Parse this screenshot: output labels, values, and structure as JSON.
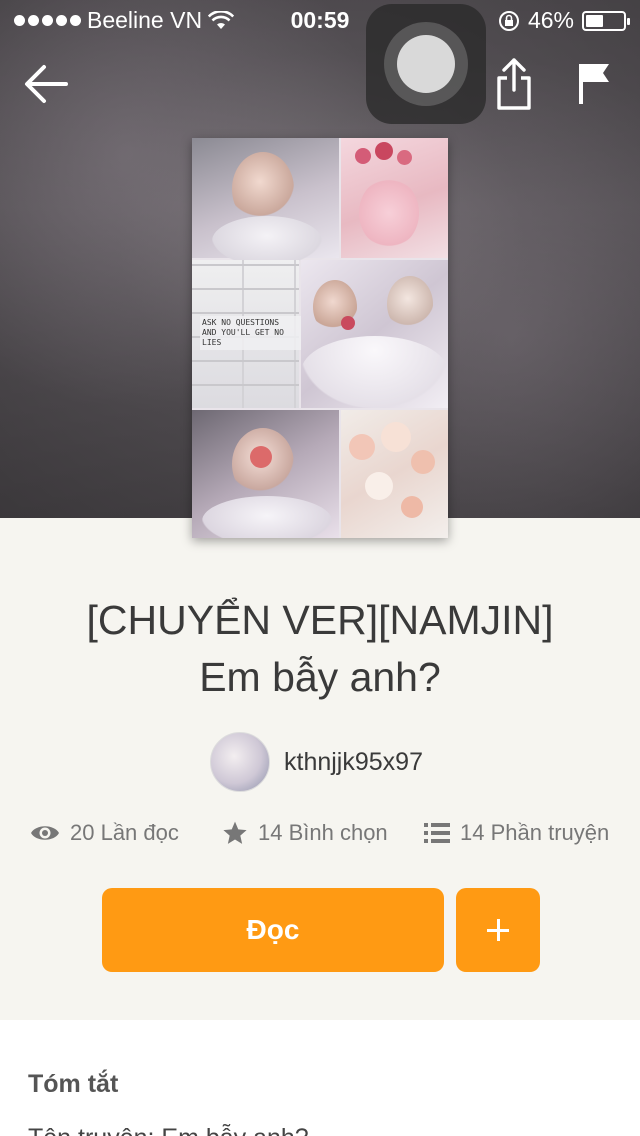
{
  "status_bar": {
    "carrier": "Beeline VN",
    "time": "00:59",
    "battery_percent_text": "46%",
    "battery_level": 0.46
  },
  "story": {
    "title_line1": "[CHUYỂN VER][NAMJIN]",
    "title_line2": "Em bẫy anh?",
    "author": "kthnjjk95x97",
    "cover_text_line1": "ASK NO QUESTIONS",
    "cover_text_line2": "AND YOU'LL GET NO LIES"
  },
  "stats": {
    "reads": "20 Lần đọc",
    "votes": "14 Bình chọn",
    "parts": "14 Phần truyện"
  },
  "actions": {
    "read_label": "Đọc"
  },
  "summary": {
    "heading": "Tóm tắt",
    "first_line": "Tên truyện: Em bẫy anh?"
  },
  "icons": [
    "back-arrow-icon",
    "share-icon",
    "flag-icon",
    "eye-icon",
    "star-icon",
    "list-icon",
    "plus-icon",
    "wifi-icon",
    "lock-rotation-icon",
    "battery-icon"
  ],
  "colors": {
    "accent": "#ff9a13",
    "background": "#f6f5f0"
  }
}
